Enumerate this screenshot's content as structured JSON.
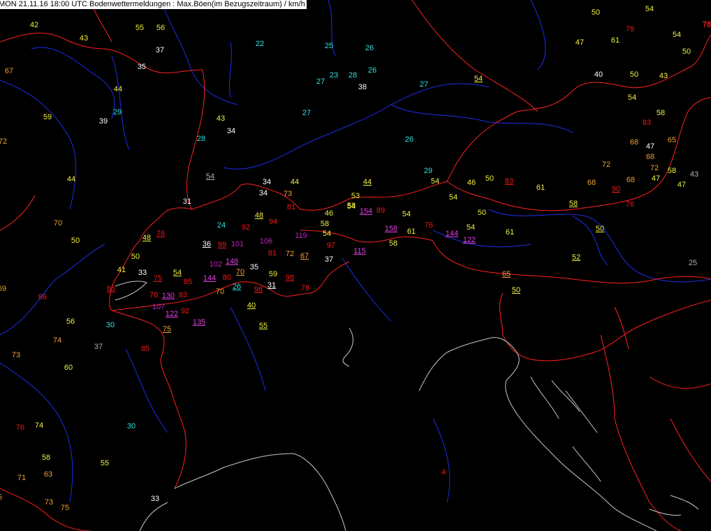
{
  "header": {
    "text": "MON 21.11.16 18:00 UTC  Bodenwettermeldungen :  Max.Böen(im Bezugszeitraum) / km/h"
  },
  "colors": {
    "background": "#000000",
    "borders": "#ff2020",
    "rivers": "#1c2ee6",
    "coast": "#c8c8c8",
    "v_lt30": "#30e0e0",
    "v_30_39": "#ffffff",
    "v_40_59": "#f0f040",
    "v_60_79": "#f0a030",
    "v_80_99": "#f01818",
    "v_100_119": "#c020c0",
    "v_120_plus": "#e040e0",
    "v_grey": "#b0b0b0"
  },
  "stations": [
    {
      "v": "42",
      "c": "v_40_59"
    },
    {
      "v": "43",
      "c": "v_40_59"
    },
    {
      "v": "55",
      "c": "v_40_59"
    },
    {
      "v": "56",
      "c": "v_40_59"
    },
    {
      "v": "37",
      "c": "v_30_39"
    },
    {
      "v": "35",
      "c": "v_30_39"
    },
    {
      "v": "67",
      "c": "v_60_79"
    },
    {
      "v": "44",
      "c": "v_40_59"
    },
    {
      "v": "59",
      "c": "v_40_59"
    },
    {
      "v": "29",
      "c": "v_lt30"
    },
    {
      "v": "39",
      "c": "v_30_39"
    },
    {
      "v": "72",
      "c": "v_60_79"
    },
    {
      "v": "43",
      "c": "v_40_59"
    },
    {
      "v": "34",
      "c": "v_30_39"
    },
    {
      "v": "28",
      "c": "v_lt30"
    },
    {
      "v": "44",
      "c": "v_40_59"
    },
    {
      "v": "22",
      "c": "v_lt30"
    },
    {
      "v": "25",
      "c": "v_lt30"
    },
    {
      "v": "26",
      "c": "v_lt30"
    },
    {
      "v": "27",
      "c": "v_lt30"
    },
    {
      "v": "23",
      "c": "v_lt30"
    },
    {
      "v": "28",
      "c": "v_lt30"
    },
    {
      "v": "26",
      "c": "v_lt30"
    },
    {
      "v": "38",
      "c": "v_30_39"
    },
    {
      "v": "27",
      "c": "v_lt30"
    },
    {
      "v": "27",
      "c": "v_lt30"
    },
    {
      "v": "26",
      "c": "v_lt30"
    },
    {
      "v": "54",
      "c": "v_grey",
      "u": true
    },
    {
      "v": "31",
      "c": "v_30_39"
    },
    {
      "v": "70",
      "c": "v_60_79"
    },
    {
      "v": "50",
      "c": "v_40_59"
    },
    {
      "v": "48",
      "c": "v_40_59",
      "u": true
    },
    {
      "v": "76",
      "c": "v_80_99",
      "u": true
    },
    {
      "v": "50",
      "c": "v_40_59"
    },
    {
      "v": "41",
      "c": "v_40_59"
    },
    {
      "v": "33",
      "c": "v_30_39"
    },
    {
      "v": "69",
      "c": "v_60_79"
    },
    {
      "v": "86",
      "c": "v_80_99"
    },
    {
      "v": "85",
      "c": "v_80_99",
      "u": true
    },
    {
      "v": "78",
      "c": "v_80_99"
    },
    {
      "v": "107",
      "c": "v_100_119"
    },
    {
      "v": "130",
      "c": "v_120_plus",
      "u": true
    },
    {
      "v": "122",
      "c": "v_120_plus",
      "u": true
    },
    {
      "v": "92",
      "c": "v_80_99"
    },
    {
      "v": "75",
      "c": "v_60_79",
      "u": true
    },
    {
      "v": "135",
      "c": "v_120_plus",
      "u": true
    },
    {
      "v": "83",
      "c": "v_80_99"
    },
    {
      "v": "75",
      "c": "v_80_99",
      "u": true
    },
    {
      "v": "54",
      "c": "v_40_59",
      "u": true
    },
    {
      "v": "85",
      "c": "v_80_99"
    },
    {
      "v": "144",
      "c": "v_120_plus",
      "u": true
    },
    {
      "v": "80",
      "c": "v_80_99"
    },
    {
      "v": "70",
      "c": "v_60_79"
    },
    {
      "v": "70",
      "c": "v_60_79",
      "u": true
    },
    {
      "v": "26",
      "c": "v_lt30",
      "u": true
    },
    {
      "v": "102",
      "c": "v_100_119"
    },
    {
      "v": "148",
      "c": "v_120_plus",
      "u": true
    },
    {
      "v": "36",
      "c": "v_30_39",
      "u": true
    },
    {
      "v": "99",
      "c": "v_80_99",
      "u": true
    },
    {
      "v": "101",
      "c": "v_100_119"
    },
    {
      "v": "24",
      "c": "v_lt30"
    },
    {
      "v": "92",
      "c": "v_80_99"
    },
    {
      "v": "48",
      "c": "v_40_59",
      "u": true
    },
    {
      "v": "94",
      "c": "v_80_99"
    },
    {
      "v": "106",
      "c": "v_100_119"
    },
    {
      "v": "81",
      "c": "v_80_99"
    },
    {
      "v": "35",
      "c": "v_30_39"
    },
    {
      "v": "59",
      "c": "v_40_59"
    },
    {
      "v": "31",
      "c": "v_30_39",
      "u": true
    },
    {
      "v": "98",
      "c": "v_80_99",
      "u": true
    },
    {
      "v": "98",
      "c": "v_80_99",
      "u": true
    },
    {
      "v": "40",
      "c": "v_40_59",
      "u": true
    },
    {
      "v": "55",
      "c": "v_40_59",
      "u": true
    },
    {
      "v": "78",
      "c": "v_80_99"
    },
    {
      "v": "72",
      "c": "v_60_79"
    },
    {
      "v": "67",
      "c": "v_60_79",
      "u": true
    },
    {
      "v": "37",
      "c": "v_30_39"
    },
    {
      "v": "97",
      "c": "v_80_99"
    },
    {
      "v": "119",
      "c": "v_100_119"
    },
    {
      "v": "58",
      "c": "v_40_59"
    },
    {
      "v": "81",
      "c": "v_80_99"
    },
    {
      "v": "34",
      "c": "v_30_39"
    },
    {
      "v": "34",
      "c": "v_30_39"
    },
    {
      "v": "44",
      "c": "v_40_59"
    },
    {
      "v": "73",
      "c": "v_60_79"
    },
    {
      "v": "46",
      "c": "v_40_59"
    },
    {
      "v": "58",
      "c": "v_40_59"
    },
    {
      "v": "54",
      "c": "v_40_59"
    },
    {
      "v": "115",
      "c": "v_120_plus",
      "u": true
    },
    {
      "v": "53",
      "c": "v_40_59"
    },
    {
      "v": "54",
      "c": "v_40_59"
    },
    {
      "v": "154",
      "c": "v_120_plus",
      "u": true
    },
    {
      "v": "89",
      "c": "v_80_99"
    },
    {
      "v": "44",
      "c": "v_40_59",
      "u": true
    },
    {
      "v": "54",
      "c": "v_40_59"
    },
    {
      "v": "158",
      "c": "v_120_plus",
      "u": true
    },
    {
      "v": "61",
      "c": "v_40_59"
    },
    {
      "v": "58",
      "c": "v_40_59"
    },
    {
      "v": "76",
      "c": "v_80_99"
    },
    {
      "v": "144",
      "c": "v_120_plus",
      "u": true
    },
    {
      "v": "122",
      "c": "v_120_plus",
      "u": true
    },
    {
      "v": "54",
      "c": "v_40_59"
    },
    {
      "v": "61",
      "c": "v_40_59"
    },
    {
      "v": "29",
      "c": "v_lt30"
    },
    {
      "v": "54",
      "c": "v_40_59"
    },
    {
      "v": "54",
      "c": "v_40_59"
    },
    {
      "v": "46",
      "c": "v_40_59"
    },
    {
      "v": "50",
      "c": "v_40_59"
    },
    {
      "v": "50",
      "c": "v_40_59"
    },
    {
      "v": "83",
      "c": "v_80_99",
      "u": true
    },
    {
      "v": "61",
      "c": "v_40_59"
    },
    {
      "v": "68",
      "c": "v_60_79"
    },
    {
      "v": "58",
      "c": "v_40_59",
      "u": true
    },
    {
      "v": "50",
      "c": "v_40_59",
      "u": true
    },
    {
      "v": "52",
      "c": "v_40_59",
      "u": true
    },
    {
      "v": "65",
      "c": "v_60_79",
      "u": true
    },
    {
      "v": "50",
      "c": "v_40_59",
      "u": true
    },
    {
      "v": "54",
      "c": "v_40_59",
      "u": true
    },
    {
      "v": "50",
      "c": "v_40_59"
    },
    {
      "v": "54",
      "c": "v_40_59"
    },
    {
      "v": "79",
      "c": "v_80_99"
    },
    {
      "v": "47",
      "c": "v_40_59"
    },
    {
      "v": "61",
      "c": "v_40_59"
    },
    {
      "v": "54",
      "c": "v_40_59"
    },
    {
      "v": "50",
      "c": "v_40_59"
    },
    {
      "v": "40",
      "c": "v_30_39"
    },
    {
      "v": "50",
      "c": "v_40_59"
    },
    {
      "v": "43",
      "c": "v_40_59"
    },
    {
      "v": "54",
      "c": "v_40_59"
    },
    {
      "v": "58",
      "c": "v_40_59"
    },
    {
      "v": "83",
      "c": "v_80_99"
    },
    {
      "v": "68",
      "c": "v_60_79"
    },
    {
      "v": "47",
      "c": "v_30_39"
    },
    {
      "v": "65",
      "c": "v_60_79"
    },
    {
      "v": "68",
      "c": "v_60_79"
    },
    {
      "v": "72",
      "c": "v_60_79"
    },
    {
      "v": "72",
      "c": "v_60_79"
    },
    {
      "v": "58",
      "c": "v_40_59"
    },
    {
      "v": "43",
      "c": "v_grey"
    },
    {
      "v": "47",
      "c": "v_40_59"
    },
    {
      "v": "47",
      "c": "v_40_59"
    },
    {
      "v": "68",
      "c": "v_60_79"
    },
    {
      "v": "90",
      "c": "v_80_99",
      "u": true
    },
    {
      "v": "76",
      "c": "v_80_99"
    },
    {
      "v": "25",
      "c": "v_grey"
    },
    {
      "v": "76",
      "c": "v_80_99"
    },
    {
      "v": "56",
      "c": "v_40_59"
    },
    {
      "v": "30",
      "c": "v_lt30"
    },
    {
      "v": "74",
      "c": "v_60_79"
    },
    {
      "v": "37",
      "c": "v_grey"
    },
    {
      "v": "73",
      "c": "v_60_79"
    },
    {
      "v": "85",
      "c": "v_80_99"
    },
    {
      "v": "60",
      "c": "v_40_59"
    },
    {
      "v": "76",
      "c": "v_80_99"
    },
    {
      "v": "74",
      "c": "v_40_59"
    },
    {
      "v": "30",
      "c": "v_lt30"
    },
    {
      "v": "58",
      "c": "v_40_59"
    },
    {
      "v": "55",
      "c": "v_40_59"
    },
    {
      "v": "71",
      "c": "v_60_79"
    },
    {
      "v": "63",
      "c": "v_60_79"
    },
    {
      "v": "73",
      "c": "v_60_79"
    },
    {
      "v": "75",
      "c": "v_60_79"
    },
    {
      "v": "33",
      "c": "v_30_39"
    },
    {
      "v": "4",
      "c": "v_80_99"
    },
    {
      "v": "5",
      "c": "v_60_79"
    },
    {
      "v": "76",
      "c": "v_80_99"
    }
  ]
}
